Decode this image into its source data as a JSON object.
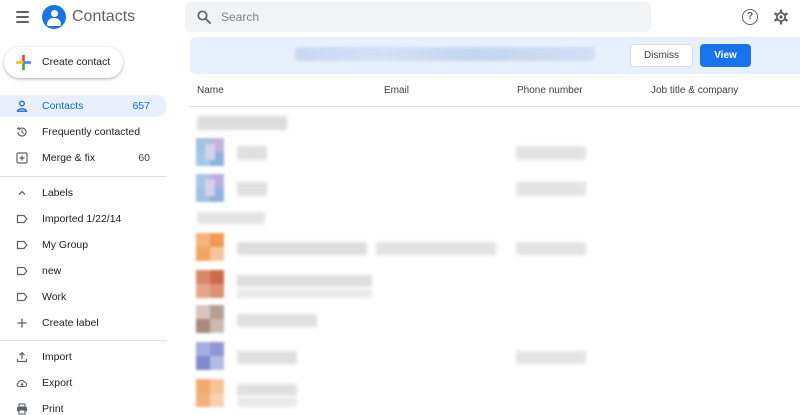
{
  "app": {
    "title": "Contacts"
  },
  "search": {
    "placeholder": "Search"
  },
  "sidebar": {
    "create_label": "Create contact",
    "items": [
      {
        "label": "Contacts",
        "count": "657"
      },
      {
        "label": "Frequently contacted",
        "count": ""
      },
      {
        "label": "Merge & fix",
        "count": "60"
      }
    ],
    "labels_header": "Labels",
    "labels": [
      {
        "label": "Imported 1/22/14"
      },
      {
        "label": "My Group"
      },
      {
        "label": "new"
      },
      {
        "label": "Work"
      }
    ],
    "create_label_item": "Create label",
    "bottom": [
      {
        "label": "Import"
      },
      {
        "label": "Export"
      },
      {
        "label": "Print"
      }
    ]
  },
  "banner": {
    "dismiss_label": "Dismiss",
    "view_label": "View"
  },
  "table": {
    "columns": [
      "Name",
      "Email",
      "Phone number",
      "Job title & company"
    ]
  },
  "colors": {
    "accent": "#1a73e8",
    "active_bg": "#e8f0fe",
    "active_text": "#1967d2",
    "icon_grey": "#5f6368"
  },
  "icons": {
    "menu": "hamburger-menu-icon",
    "search": "search-icon",
    "help": "help-icon",
    "settings": "gear-icon"
  }
}
